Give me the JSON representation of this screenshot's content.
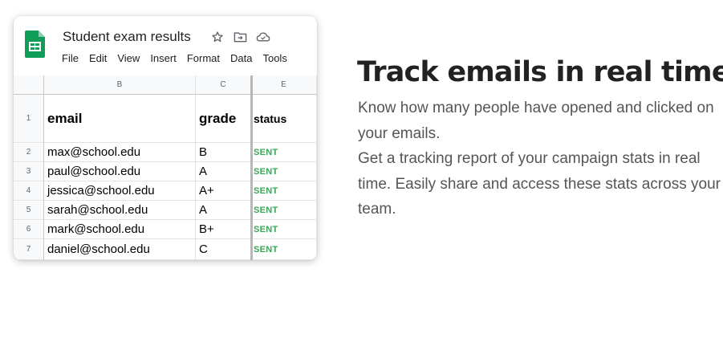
{
  "spreadsheet": {
    "title": "Student exam results",
    "menu": [
      "File",
      "Edit",
      "View",
      "Insert",
      "Format",
      "Data",
      "Tools"
    ],
    "icons": [
      "sheets-logo-icon",
      "star-icon",
      "move-to-folder-icon",
      "cloud-status-icon"
    ],
    "column_headers": [
      "B",
      "C",
      "E"
    ],
    "row_numbers": [
      "1",
      "2",
      "3",
      "4",
      "5",
      "6",
      "7"
    ],
    "table_header": {
      "email": "email",
      "grade": "grade",
      "status": "status"
    },
    "rows": [
      {
        "email": "max@school.edu",
        "grade": "B",
        "status": "SENT"
      },
      {
        "email": "paul@school.edu",
        "grade": "A",
        "status": "SENT"
      },
      {
        "email": "jessica@school.edu",
        "grade": "A+",
        "status": "SENT"
      },
      {
        "email": "sarah@school.edu",
        "grade": "A",
        "status": "SENT"
      },
      {
        "email": "mark@school.edu",
        "grade": "B+",
        "status": "SENT"
      },
      {
        "email": "daniel@school.edu",
        "grade": "C",
        "status": "SENT"
      }
    ],
    "colors": {
      "sent": "#34a853",
      "sheets_green": "#0f9d58"
    }
  },
  "feature": {
    "headline": "Track emails in real time",
    "paragraph_1": "Know how many people have opened and clicked on your emails.",
    "paragraph_2": "Get a tracking report of your campaign stats in real time. Easily share and access these stats across your team."
  }
}
